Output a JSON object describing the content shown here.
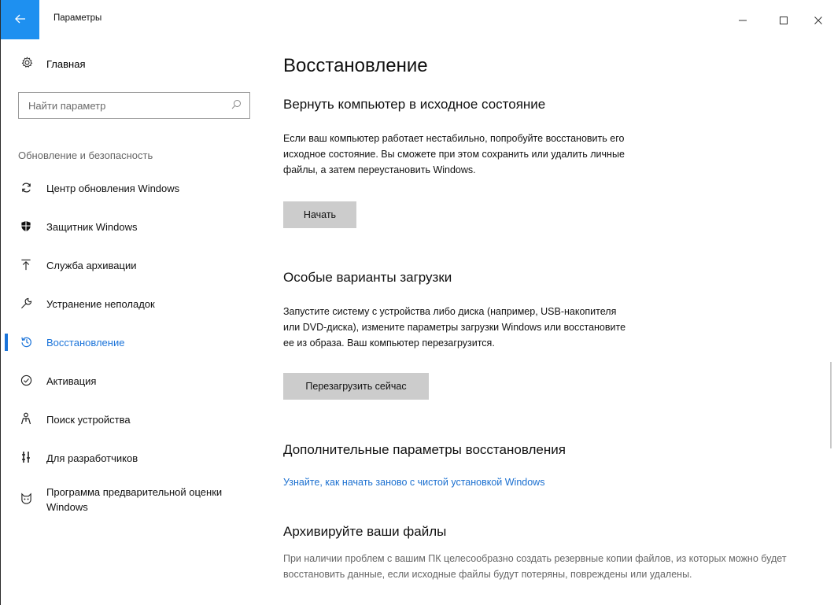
{
  "window": {
    "title": "Параметры",
    "back_icon": "back-arrow-icon",
    "controls": {
      "minimize": "–",
      "maximize": "☐",
      "close": "✕"
    }
  },
  "sidebar": {
    "home_label": "Главная",
    "search_placeholder": "Найти параметр",
    "section_label": "Обновление и безопасность",
    "items": [
      {
        "label": "Центр обновления Windows",
        "icon": "sync-icon",
        "glyph": "⟳"
      },
      {
        "label": "Защитник Windows",
        "icon": "shield-icon",
        "glyph": "⛊"
      },
      {
        "label": "Служба архивации",
        "icon": "backup-upload-icon",
        "glyph": "⤒"
      },
      {
        "label": "Устранение неполадок",
        "icon": "wrench-icon",
        "glyph": "⚒"
      },
      {
        "label": "Восстановление",
        "icon": "recovery-history-icon",
        "glyph": "↺",
        "active": true
      },
      {
        "label": "Активация",
        "icon": "check-circle-icon",
        "glyph": "✓"
      },
      {
        "label": "Поиск устройства",
        "icon": "find-device-person-icon",
        "glyph": "♙"
      },
      {
        "label": "Для разработчиков",
        "icon": "developer-tools-icon",
        "glyph": "⚙"
      },
      {
        "label": "Программа предварительной оценки Windows",
        "icon": "insider-cat-icon",
        "glyph": "☺"
      }
    ]
  },
  "main": {
    "title": "Восстановление",
    "reset": {
      "heading": "Вернуть компьютер в исходное состояние",
      "text": "Если ваш компьютер работает нестабильно, попробуйте восстановить его исходное состояние. Вы сможете при этом сохранить или удалить личные файлы, а затем переустановить Windows.",
      "button": "Начать"
    },
    "advanced_startup": {
      "heading": "Особые варианты загрузки",
      "text": "Запустите систему с устройства либо диска (например, USB-накопителя или DVD-диска), измените параметры загрузки Windows или восстановите ее из образа. Ваш компьютер перезагрузится.",
      "button": "Перезагрузить сейчас"
    },
    "more_options": {
      "heading": "Дополнительные параметры восстановления",
      "link": "Узнайте, как начать заново с чистой установкой Windows"
    },
    "backup": {
      "heading": "Архивируйте ваши файлы",
      "text": "При наличии проблем с вашим ПК целесообразно создать резервные копии файлов, из которых можно будет восстановить данные, если исходные файлы будут потеряны, повреждены или удалены."
    }
  },
  "colors": {
    "accent": "#1a73d9",
    "back_button": "#1e90f0",
    "button_bg": "#cccccc"
  }
}
